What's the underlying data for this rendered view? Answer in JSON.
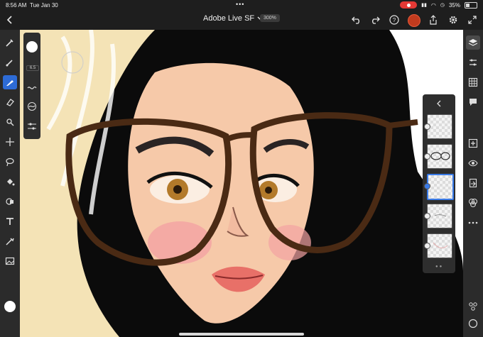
{
  "status": {
    "time": "8:56 AM",
    "date": "Tue Jan 30",
    "battery": "35%"
  },
  "header": {
    "title": "Adobe Live SF",
    "zoom": "300%"
  },
  "brush": {
    "size_value": "6.5"
  },
  "icons": {
    "back": "chevron-left-icon",
    "undo": "undo-icon",
    "redo": "redo-icon",
    "help": "help-icon",
    "share": "share-icon",
    "settings": "gear-icon",
    "expand": "expand-icon"
  },
  "colors": {
    "accent": "#2d6bd6",
    "record": "#e53935",
    "avatar": "#c23b1e"
  }
}
